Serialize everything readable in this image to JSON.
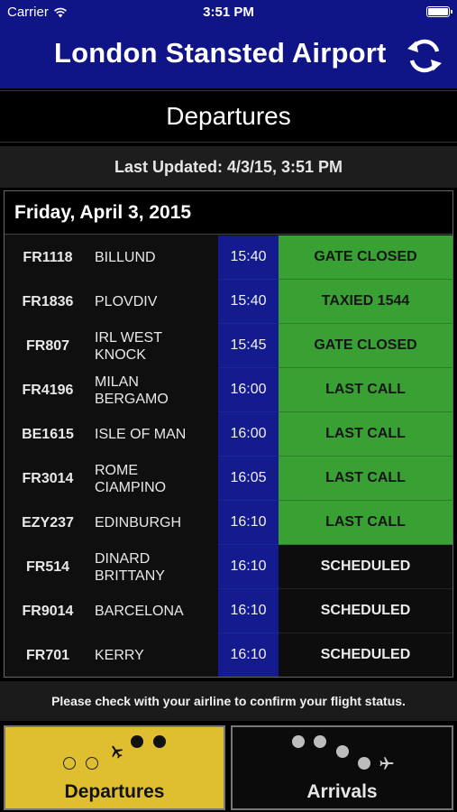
{
  "status_bar": {
    "carrier": "Carrier",
    "time": "3:51 PM"
  },
  "header": {
    "title": "London Stansted Airport"
  },
  "section": {
    "title": "Departures"
  },
  "updated": {
    "text": "Last Updated: 4/3/15, 3:51 PM"
  },
  "board": {
    "date": "Friday, April 3, 2015",
    "rows": [
      {
        "flight": "FR1118",
        "destination": "BILLUND",
        "time": "15:40",
        "status": "GATE CLOSED",
        "status_type": "green"
      },
      {
        "flight": "FR1836",
        "destination": "PLOVDIV",
        "time": "15:40",
        "status": "TAXIED 1544",
        "status_type": "green"
      },
      {
        "flight": "FR807",
        "destination": "IRL WEST KNOCK",
        "time": "15:45",
        "status": "GATE CLOSED",
        "status_type": "green"
      },
      {
        "flight": "FR4196",
        "destination": "MILAN BERGAMO",
        "time": "16:00",
        "status": "LAST CALL",
        "status_type": "green"
      },
      {
        "flight": "BE1615",
        "destination": "ISLE OF MAN",
        "time": "16:00",
        "status": "LAST CALL",
        "status_type": "green"
      },
      {
        "flight": "FR3014",
        "destination": "ROME CIAMPINO",
        "time": "16:05",
        "status": "LAST CALL",
        "status_type": "green"
      },
      {
        "flight": "EZY237",
        "destination": "EDINBURGH",
        "time": "16:10",
        "status": "LAST CALL",
        "status_type": "green"
      },
      {
        "flight": "FR514",
        "destination": "DINARD BRITTANY",
        "time": "16:10",
        "status": "SCHEDULED",
        "status_type": "dark"
      },
      {
        "flight": "FR9014",
        "destination": "BARCELONA",
        "time": "16:10",
        "status": "SCHEDULED",
        "status_type": "dark"
      },
      {
        "flight": "FR701",
        "destination": "KERRY",
        "time": "16:10",
        "status": "SCHEDULED",
        "status_type": "dark"
      }
    ]
  },
  "note": {
    "text": "Please check with your airline to confirm your flight status."
  },
  "tabs": {
    "departures": {
      "label": "Departures",
      "selected": true
    },
    "arrivals": {
      "label": "Arrivals",
      "selected": false
    }
  },
  "icons": {
    "wifi": "wifi-icon",
    "battery": "battery-icon",
    "refresh": "refresh-icon",
    "plane": "plane-icon"
  },
  "colors": {
    "header_blue": "#0f1486",
    "time_blue": "#131b8f",
    "status_green": "#39a033",
    "tab_yellow": "#dfbf2f"
  }
}
